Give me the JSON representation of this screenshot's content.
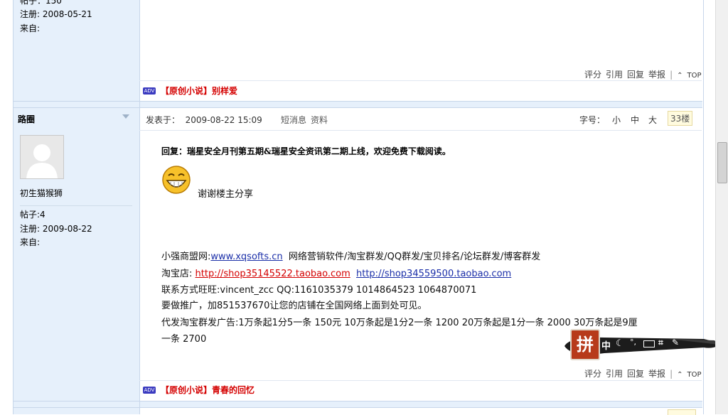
{
  "post_prev": {
    "posts_line": "帖子：150",
    "register_label": "注册:",
    "register_date": "2008-05-21",
    "from_label": "来自:",
    "actions": [
      "评分",
      "引用",
      "回复",
      "举报"
    ],
    "top_label": "TOP",
    "adv_badge": "ADV",
    "adv_text": "【原创小说】别样爱"
  },
  "post": {
    "username": "路圈",
    "rank": "初生猫猴狮",
    "posts_label": "帖子:",
    "posts_value": "4",
    "register_label": "注册:",
    "register_date": "2009-08-22",
    "from_label": "来自:",
    "posted_label": "发表于：",
    "posted_time": "2009-08-22 15:09",
    "short_msg": "短消息",
    "profile": "资料",
    "font_label": "字号：",
    "font_small": "小",
    "font_mid": "中",
    "font_big": "大",
    "floor": "33楼",
    "reply_title": "回复：瑞星安全月刊第五期&瑞星安全资讯第二期上线，欢迎免费下载阅读。",
    "thanks": "谢谢楼主分享",
    "sig_line1_prefix": "小强商盟网:",
    "sig_link1": "www.xqsofts.cn",
    "sig_line1_suffix": "网络营销软件/淘宝群发/QQ群发/宝贝排名/论坛群发/博客群发",
    "sig_line2_prefix": "淘宝店:",
    "sig_link2": "http://shop35145522.taobao.com",
    "sig_link3": "http://shop34559500.taobao.com",
    "sig_line3": "联系方式旺旺:vincent_zcc  QQ:1161035379 1014864523  1064870071",
    "sig_line4": "要做推广，加851537670让您的店铺在全国网络上面到处可见。",
    "sig_line5": "代发淘宝群发广告:1万条起1分5一条  150元  10万条起是1分2一条  1200  20万条起是1分一条  2000  30万条起是9厘",
    "sig_line6": "一条  2700",
    "actions": [
      "评分",
      "引用",
      "回复",
      "举报"
    ],
    "top_label": "TOP",
    "adv_badge": "ADV",
    "adv_text": "【原创小说】青春的回忆"
  },
  "ime": {
    "logo_char": "拼",
    "mode": "中",
    "icons": [
      "moon-icon",
      "punct-icon",
      "keyboard-icon",
      "tools-icon",
      "wrench-icon"
    ]
  }
}
